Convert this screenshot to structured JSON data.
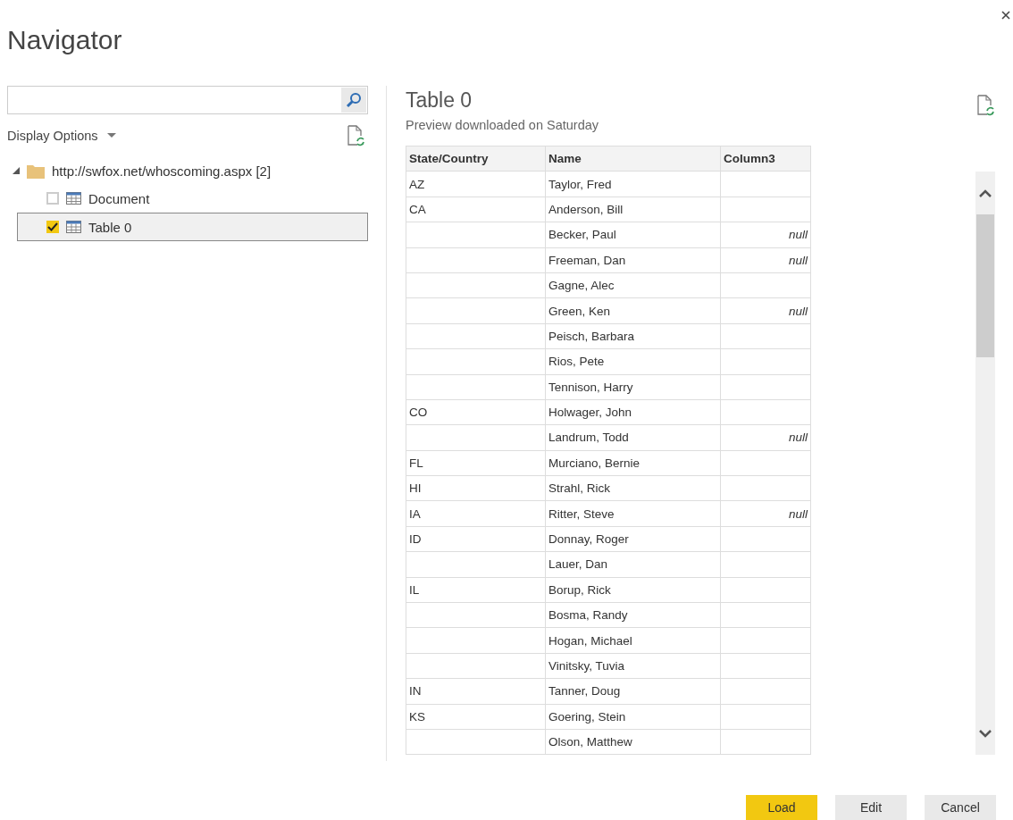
{
  "window": {
    "title": "Navigator"
  },
  "display_options": {
    "label": "Display Options"
  },
  "tree": {
    "label": "http://swfox.net/whoscoming.aspx [2]",
    "expanded": true,
    "children": [
      {
        "label": "Document",
        "checked": false,
        "selected": false
      },
      {
        "label": "Table 0",
        "checked": true,
        "selected": true
      }
    ]
  },
  "preview": {
    "title": "Table 0",
    "subtitle": "Preview downloaded on Saturday"
  },
  "table": {
    "columns": [
      "State/Country",
      "Name",
      "Column3"
    ],
    "rows": [
      [
        "AZ",
        "Taylor, Fred",
        ""
      ],
      [
        "CA",
        "Anderson, Bill",
        ""
      ],
      [
        "",
        "Becker, Paul",
        "null"
      ],
      [
        "",
        "Freeman, Dan",
        "null"
      ],
      [
        "",
        "Gagne, Alec",
        ""
      ],
      [
        "",
        "Green, Ken",
        "null"
      ],
      [
        "",
        "Peisch, Barbara",
        ""
      ],
      [
        "",
        "Rios, Pete",
        ""
      ],
      [
        "",
        "Tennison, Harry",
        ""
      ],
      [
        "CO",
        "Holwager, John",
        ""
      ],
      [
        "",
        "Landrum, Todd",
        "null"
      ],
      [
        "FL",
        "Murciano, Bernie",
        ""
      ],
      [
        "HI",
        "Strahl, Rick",
        ""
      ],
      [
        "IA",
        "Ritter, Steve",
        "null"
      ],
      [
        "ID",
        "Donnay, Roger",
        ""
      ],
      [
        "",
        "Lauer, Dan",
        ""
      ],
      [
        "IL",
        "Borup, Rick",
        ""
      ],
      [
        "",
        "Bosma, Randy",
        ""
      ],
      [
        "",
        "Hogan, Michael",
        ""
      ],
      [
        "",
        "Vinitsky, Tuvia",
        ""
      ],
      [
        "IN",
        "Tanner, Doug",
        ""
      ],
      [
        "KS",
        "Goering, Stein",
        ""
      ],
      [
        "",
        "Olson, Matthew",
        ""
      ]
    ]
  },
  "buttons": [
    {
      "label": "Load",
      "kind": "primary"
    },
    {
      "label": "Edit",
      "kind": "secondary"
    },
    {
      "label": "Cancel",
      "kind": "secondary"
    }
  ]
}
